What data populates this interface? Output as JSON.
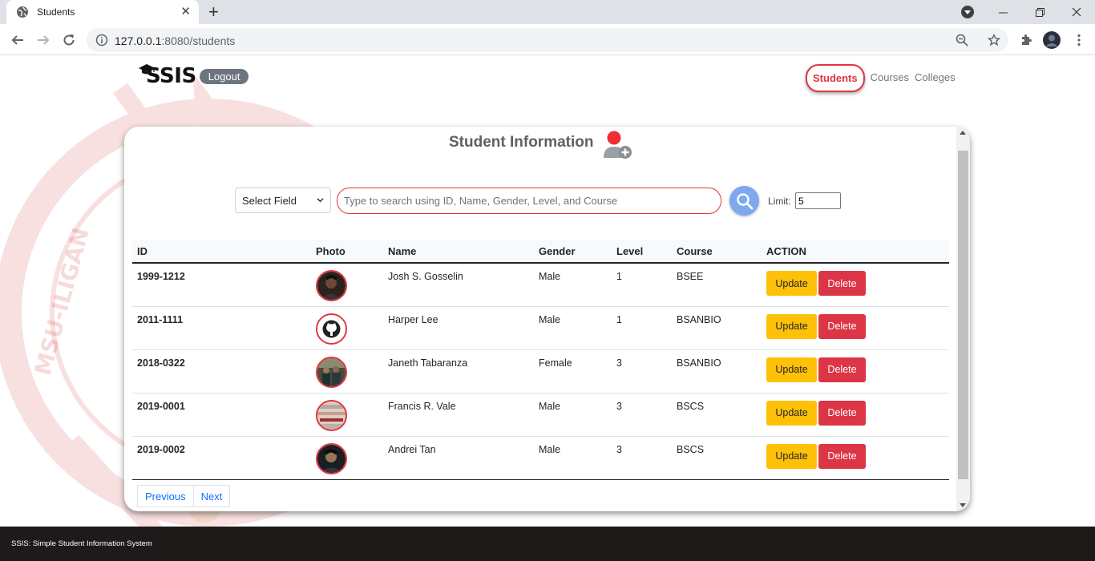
{
  "browser": {
    "tab_title": "Students",
    "new_tab_label": "+",
    "url_host": "127.0.0.1",
    "url_rest": ":8080/students"
  },
  "navbar": {
    "brand": "SSIS",
    "logout_label": "Logout",
    "links": [
      {
        "label": "Students",
        "active": true
      },
      {
        "label": "Courses",
        "active": false
      },
      {
        "label": "Colleges",
        "active": false
      }
    ]
  },
  "main": {
    "title": "Student Information",
    "field_select": "Select Field",
    "search_placeholder": "Type to search using ID, Name, Gender, Level, and Course",
    "limit_label": "Limit:",
    "limit_value": "5",
    "columns": [
      "ID",
      "Photo",
      "Name",
      "Gender",
      "Level",
      "Course",
      "ACTION"
    ],
    "rows": [
      {
        "id": "1999-1212",
        "photo": "photo-dark",
        "name": "Josh S. Gosselin",
        "gender": "Male",
        "level": "1",
        "course": "BSEE"
      },
      {
        "id": "2011-1111",
        "photo": "github-icon",
        "name": "Harper Lee",
        "gender": "Male",
        "level": "1",
        "course": "BSANBIO"
      },
      {
        "id": "2018-0322",
        "photo": "photo-group",
        "name": "Janeth Tabaranza",
        "gender": "Female",
        "level": "3",
        "course": "BSANBIO"
      },
      {
        "id": "2019-0001",
        "photo": "photo-light",
        "name": "Francis R. Vale",
        "gender": "Male",
        "level": "3",
        "course": "BSCS"
      },
      {
        "id": "2019-0002",
        "photo": "photo-portrait",
        "name": "Andrei Tan",
        "gender": "Male",
        "level": "3",
        "course": "BSCS"
      }
    ],
    "update_label": "Update",
    "delete_label": "Delete",
    "previous_label": "Previous",
    "next_label": "Next"
  },
  "footer": {
    "text": "SSIS: Simple Student Information System"
  },
  "colors": {
    "accent": "#e0343d",
    "update": "#ffc107",
    "delete": "#dc3545",
    "search_button": "#7ea9ef",
    "footer_bg": "#1e1a1a"
  }
}
